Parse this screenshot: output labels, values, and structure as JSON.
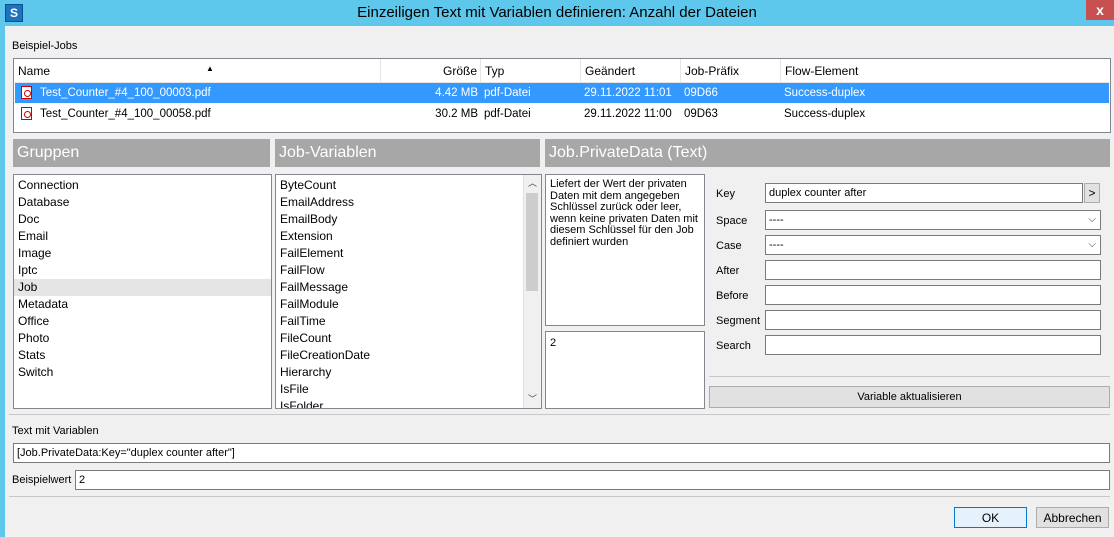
{
  "window": {
    "title": "Einzeiligen Text mit Variablen definieren: Anzahl der Dateien",
    "app_icon_letter": "S",
    "close_glyph": "x"
  },
  "jobs_section": {
    "label": "Beispiel-Jobs",
    "columns": [
      "Name",
      "Größe",
      "Typ",
      "Geändert",
      "Job-Präfix",
      "Flow-Element"
    ],
    "rows": [
      {
        "name": "Test_Counter_#4_100_00003.pdf",
        "size": "4.42 MB",
        "type": "pdf-Datei",
        "modified": "29.11.2022 11:01",
        "prefix": "09D66",
        "flow": "Success-duplex",
        "selected": true
      },
      {
        "name": "Test_Counter_#4_100_00058.pdf",
        "size": "30.2 MB",
        "type": "pdf-Datei",
        "modified": "29.11.2022 11:00",
        "prefix": "09D63",
        "flow": "Success-duplex",
        "selected": false
      }
    ]
  },
  "groups": {
    "header": "Gruppen",
    "items": [
      "Connection",
      "Database",
      "Doc",
      "Email",
      "Image",
      "Iptc",
      "Job",
      "Metadata",
      "Office",
      "Photo",
      "Stats",
      "Switch"
    ],
    "selected": "Job"
  },
  "job_variables": {
    "header": "Job-Variablen",
    "items": [
      "ByteCount",
      "EmailAddress",
      "EmailBody",
      "Extension",
      "FailElement",
      "FailFlow",
      "FailMessage",
      "FailModule",
      "FailTime",
      "FileCount",
      "FileCreationDate",
      "Hierarchy",
      "IsFile",
      "IsFolder"
    ]
  },
  "detail": {
    "header": "Job.PrivateData (Text)",
    "description": "Liefert der Wert der privaten Daten mit dem angegeben Schlüssel zurück oder leer, wenn keine privaten Daten mit diesem Schlüssel für den Job definiert wurden",
    "preview_value": "2",
    "params": {
      "key_label": "Key",
      "key_value": "duplex counter after",
      "key_button": ">",
      "space_label": "Space",
      "space_value": "----",
      "case_label": "Case",
      "case_value": "----",
      "after_label": "After",
      "after_value": "",
      "before_label": "Before",
      "before_value": "",
      "segment_label": "Segment",
      "segment_value": "",
      "search_label": "Search",
      "search_value": ""
    },
    "update_button": "Variable aktualisieren"
  },
  "text_with_variables": {
    "label": "Text mit Variablen",
    "value": "[Job.PrivateData:Key=\"duplex counter after\"]"
  },
  "sample_value": {
    "label": "Beispielwert",
    "value": "2"
  },
  "footer": {
    "ok_label": "OK",
    "cancel_label": "Abbrechen"
  }
}
